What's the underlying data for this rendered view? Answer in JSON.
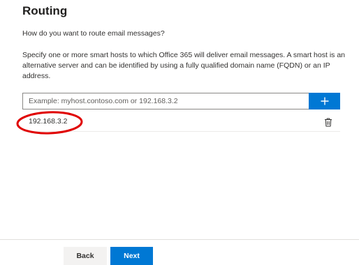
{
  "page": {
    "title": "Routing",
    "question": "How do you want to route email messages?",
    "description": "Specify one or more smart hosts to which Office 365 will deliver email messages. A smart host is an alternative server and can be identified by using a fully qualified domain name (FQDN) or an IP address."
  },
  "smart_host": {
    "placeholder": "Example: myhost.contoso.com or 192.168.3.2",
    "value": "",
    "add_icon": "plus-icon",
    "entries": [
      {
        "value": "192.168.3.2",
        "delete_icon": "trash-icon"
      }
    ]
  },
  "annotation": {
    "shape": "ellipse",
    "color": "#e00000"
  },
  "footer": {
    "back_label": "Back",
    "next_label": "Next"
  },
  "colors": {
    "accent": "#0078d4",
    "secondary_button": "#f3f2f1"
  }
}
